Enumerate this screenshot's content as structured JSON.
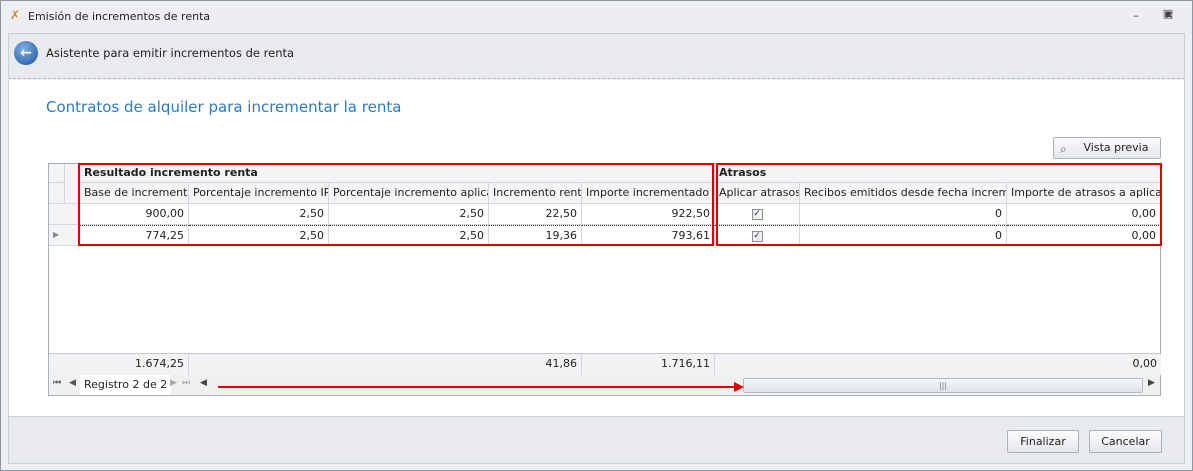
{
  "window": {
    "title": "Emisión de incrementos de renta",
    "icon": "wrench-icon"
  },
  "header": {
    "title": "Asistente para emitir incrementos de renta",
    "back_icon": "back-arrow-icon"
  },
  "page": {
    "title": "Contratos de alquiler para incrementar la renta"
  },
  "toolbar": {
    "preview_label": "Vista previa"
  },
  "grid": {
    "bands": [
      {
        "label": "Resultado incremento renta"
      },
      {
        "label": "Atrasos"
      }
    ],
    "columns": [
      "Base de incremento",
      "Porcentaje incremento IPC",
      "Porcentaje incremento aplicado",
      "Incremento renta",
      "Importe incrementado",
      "Aplicar atrasos",
      "Recibos emitidos desde fecha incremento",
      "Importe de atrasos a aplicar"
    ],
    "rows": [
      [
        "900,00",
        "2,50",
        "2,50",
        "22,50",
        "922,50",
        true,
        "0",
        "0,00"
      ],
      [
        "774,25",
        "2,50",
        "2,50",
        "19,36",
        "793,61",
        true,
        "0",
        "0,00"
      ]
    ],
    "totals": {
      "base": "1.674,25",
      "incremento": "41,86",
      "importe": "1.716,11",
      "atrasos": "0,00"
    },
    "navigator": {
      "record_text": "Registro 2 de 2"
    },
    "highlight_color": "#e00000"
  },
  "footer": {
    "finish_label": "Finalizar",
    "cancel_label": "Cancelar"
  }
}
